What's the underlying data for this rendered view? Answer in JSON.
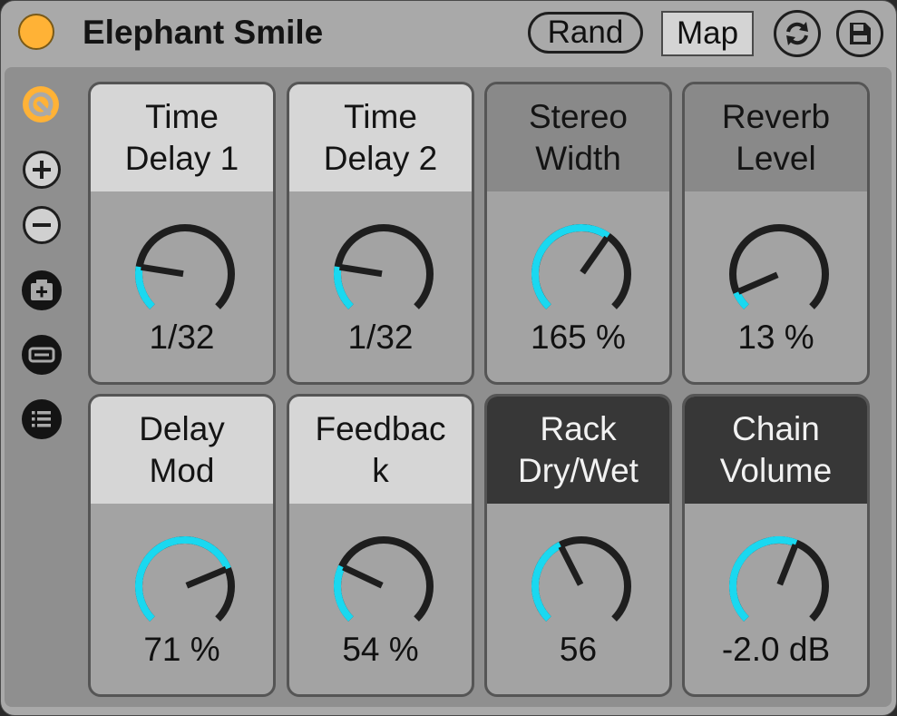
{
  "device": {
    "title": "Elephant Smile",
    "rand_label": "Rand",
    "map_label": "Map",
    "colors": {
      "onoff": "#ffb236",
      "knob_track": "#1e1e1e",
      "knob_fill": "#1ad8f0"
    }
  },
  "sidebar": {
    "buttons": [
      {
        "name": "hotswap-icon"
      },
      {
        "name": "plus-icon"
      },
      {
        "name": "minus-icon"
      },
      {
        "name": "add-variation-icon"
      },
      {
        "name": "remove-variation-icon"
      },
      {
        "name": "list-icon"
      }
    ]
  },
  "macros": [
    {
      "label": "Time\nDelay 1",
      "value": "1/32",
      "fraction": 0.2,
      "style": "light"
    },
    {
      "label": "Time\nDelay 2",
      "value": "1/32",
      "fraction": 0.2,
      "style": "light"
    },
    {
      "label": "Stereo\nWidth",
      "value": "165 %",
      "fraction": 0.63,
      "style": "mid"
    },
    {
      "label": "Reverb\nLevel",
      "value": "13 %",
      "fraction": 0.08,
      "style": "mid"
    },
    {
      "label": "Delay\nMod",
      "value": "71 %",
      "fraction": 0.75,
      "style": "light"
    },
    {
      "label": "Feedbac\nk",
      "value": "54 %",
      "fraction": 0.26,
      "style": "light"
    },
    {
      "label": "Rack\nDry/Wet",
      "value": "56",
      "fraction": 0.4,
      "style": "dark"
    },
    {
      "label": "Chain\nVolume",
      "value": "-2.0 dB",
      "fraction": 0.58,
      "style": "dark"
    }
  ]
}
